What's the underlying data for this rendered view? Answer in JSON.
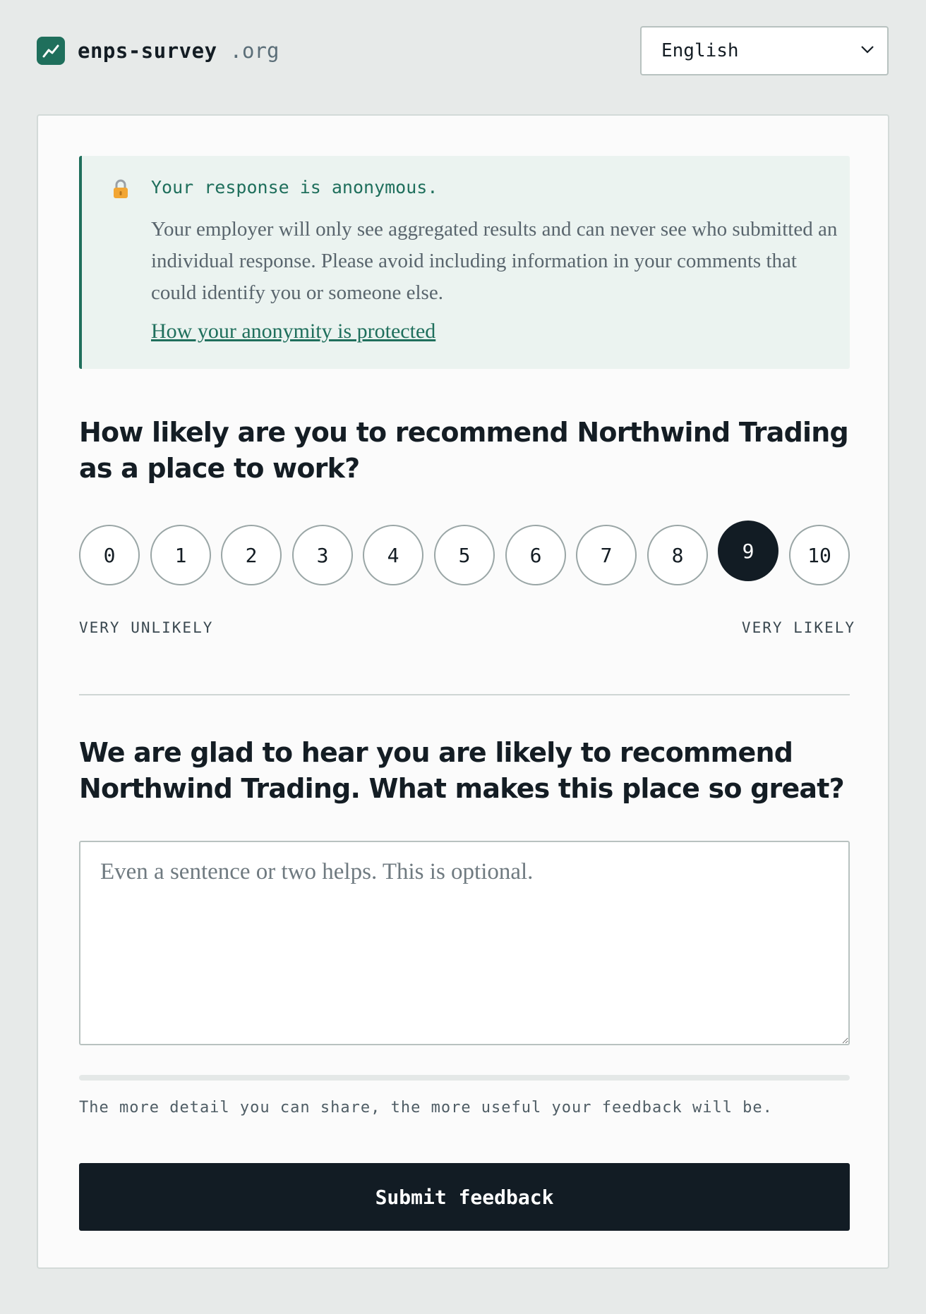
{
  "header": {
    "brand_name": "enps-survey",
    "brand_tld": ".org",
    "language": "English"
  },
  "notice": {
    "icon": "lock-icon",
    "title": "Your response is anonymous.",
    "body": "Your employer will only see aggregated results and can never see who submitted an individual response. Please avoid including information in your comments that could identify you or someone else.",
    "link": "How your anonymity is protected"
  },
  "question": {
    "text": "How likely are you to recommend Northwind Trading as a place to work?",
    "scale": [
      "0",
      "1",
      "2",
      "3",
      "4",
      "5",
      "6",
      "7",
      "8",
      "9",
      "10"
    ],
    "selected": "9",
    "low_label": "VERY UNLIKELY",
    "high_label": "VERY LIKELY"
  },
  "followup": {
    "text": "We are glad to hear you are likely to recommend Northwind Trading. What makes this place so great?",
    "value": "",
    "placeholder": "Even a sentence or two helps. This is optional.",
    "detail_progress": 0,
    "hint": "The more detail you can share, the more useful your feedback will be."
  },
  "submit_label": "Submit feedback",
  "colors": {
    "accent": "#1f6f5c",
    "selected": "#121c24",
    "background": "#e7eae9"
  }
}
